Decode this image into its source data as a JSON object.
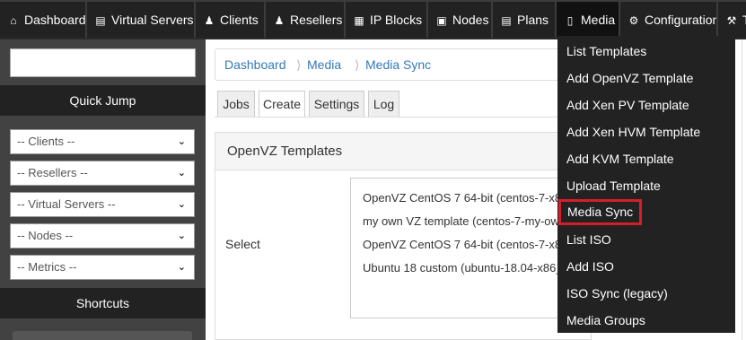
{
  "nav": {
    "tabs": [
      {
        "label": "Dashboard",
        "icon": "home-icon",
        "glyph": "⌂"
      },
      {
        "label": "Virtual Servers",
        "icon": "server-icon",
        "glyph": "▤"
      },
      {
        "label": "Clients",
        "icon": "users-icon",
        "glyph": "♟"
      },
      {
        "label": "Resellers",
        "icon": "user-icon",
        "glyph": "♟"
      },
      {
        "label": "IP Blocks",
        "icon": "grid-icon",
        "glyph": "▦"
      },
      {
        "label": "Nodes",
        "icon": "node-icon",
        "glyph": "▣"
      },
      {
        "label": "Plans",
        "icon": "plans-icon",
        "glyph": "▤"
      },
      {
        "label": "Media",
        "icon": "file-icon",
        "glyph": "▯"
      },
      {
        "label": "Configuration",
        "icon": "gear-icon",
        "glyph": "⚙"
      },
      {
        "label": "T",
        "icon": "wrench-icon",
        "glyph": "⚒"
      }
    ]
  },
  "sidebar": {
    "search_value": "",
    "quick_jump_label": "Quick Jump",
    "selects": [
      {
        "value": "-- Clients --"
      },
      {
        "value": "-- Resellers --"
      },
      {
        "value": "-- Virtual Servers --"
      },
      {
        "value": "-- Nodes --"
      },
      {
        "value": "-- Metrics --"
      }
    ],
    "shortcuts_label": "Shortcuts"
  },
  "breadcrumb": [
    "Dashboard",
    "Media",
    "Media Sync"
  ],
  "subtabs": [
    "Jobs",
    "Create",
    "Settings",
    "Log"
  ],
  "active_subtab": "Create",
  "panel": {
    "title": "OpenVZ Templates",
    "select_label": "Select",
    "options": [
      "OpenVZ CentOS 7 64-bit (centos-7-x8",
      "my own VZ template (centos-7-my-ow",
      "OpenVZ CentOS 7 64-bit (centos-7-x8",
      "Ubuntu 18 custom (ubuntu-18.04-x86_"
    ]
  },
  "media_menu": {
    "items": [
      "List Templates",
      "Add OpenVZ Template",
      "Add Xen PV Template",
      "Add Xen HVM Template",
      "Add KVM Template",
      "Upload Template",
      "Media Sync",
      "List ISO",
      "Add ISO",
      "ISO Sync (legacy)",
      "Media Groups"
    ],
    "highlighted": "Media Sync",
    "highlight_color": "#d31f2a"
  }
}
